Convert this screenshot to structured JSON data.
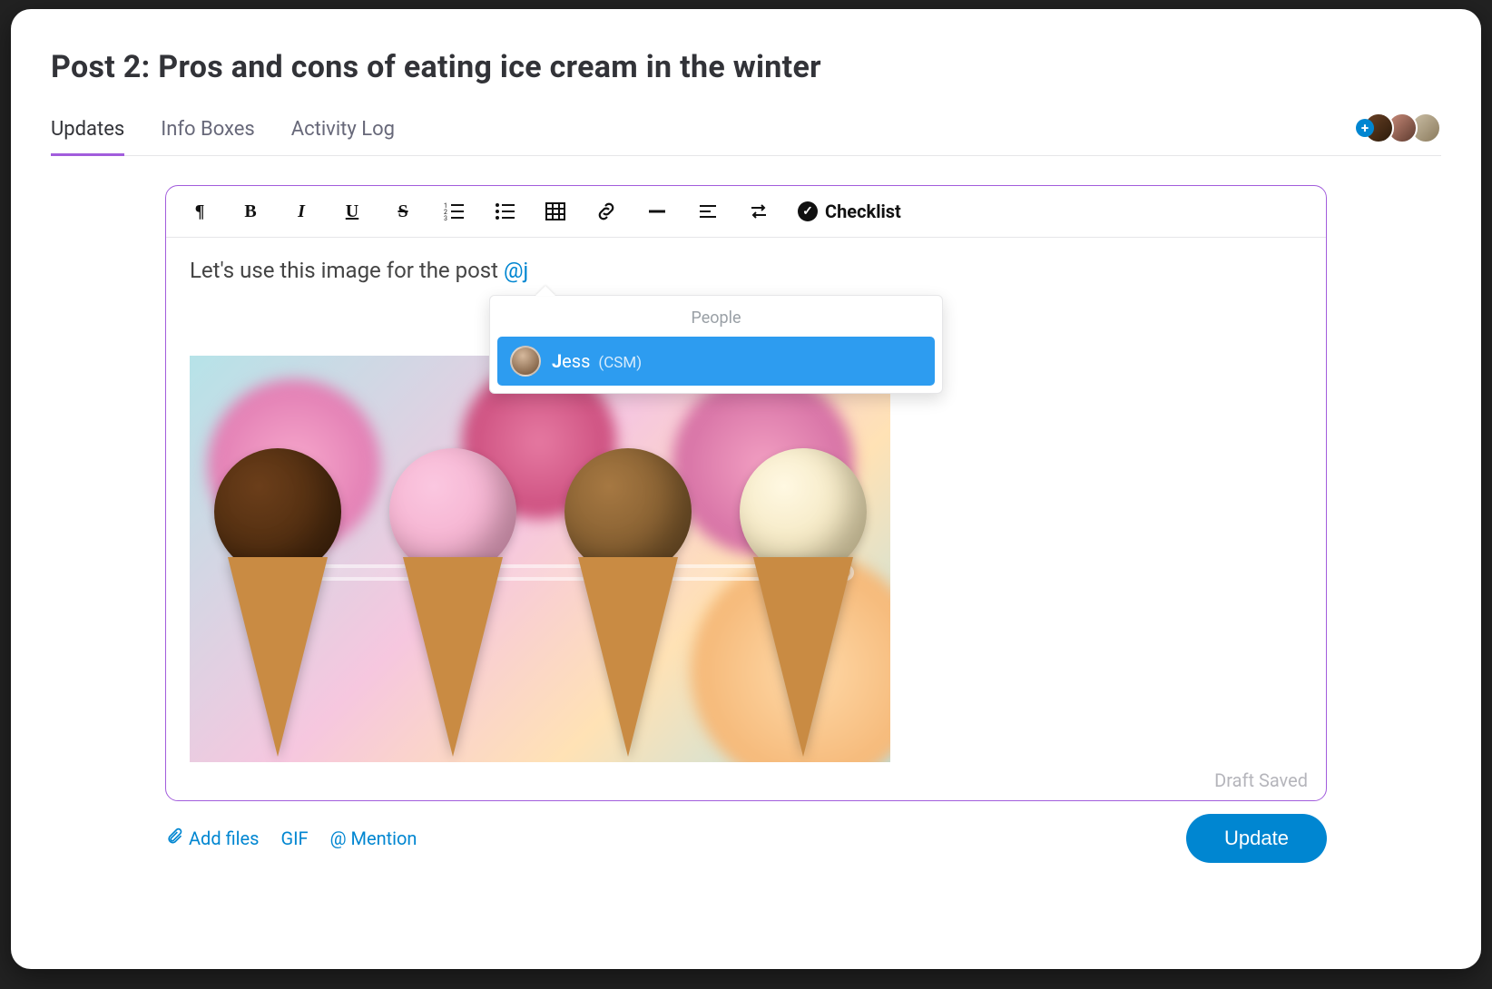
{
  "title": "Post 2: Pros and cons of eating ice cream in the winter",
  "tabs": [
    {
      "label": "Updates",
      "active": true
    },
    {
      "label": "Info Boxes",
      "active": false
    },
    {
      "label": "Activity Log",
      "active": false
    }
  ],
  "toolbar": {
    "checklist_label": "Checklist"
  },
  "content": {
    "text_before_mention": "Let's use this image for the post ",
    "mention_text": "@j"
  },
  "mention_popup": {
    "section_label": "People",
    "people": [
      {
        "name_bold_prefix": "J",
        "name_rest": "ess",
        "role": "(CSM)"
      }
    ]
  },
  "footer": {
    "draft_status": "Draft Saved",
    "add_files": "Add files",
    "gif": "GIF",
    "mention": "@ Mention",
    "update_button": "Update"
  },
  "colors": {
    "accent_purple": "#a25ddc",
    "link_blue": "#0086d1",
    "highlight_blue": "#2d9cf0"
  }
}
